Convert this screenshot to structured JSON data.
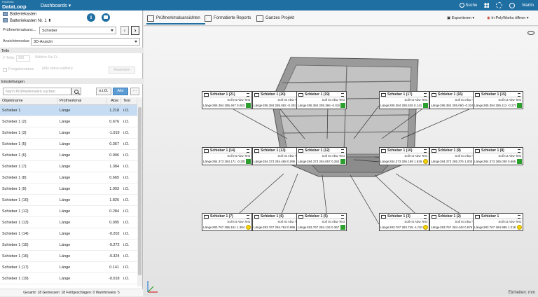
{
  "topbar": {
    "logo_small": "PolyWorks",
    "logo_large": "DataLoop",
    "menu": "Dashboards ▾",
    "search": "Suche",
    "user": "Martin"
  },
  "project": {
    "name": "Batteriekasten",
    "piece": "Batteriekasten Nr. 1"
  },
  "filters": {
    "feature_label": "Prüfmerkmalsans...",
    "feature_value": "Schieber",
    "view_label": "Ansichtsmodus:",
    "view_value": "3D-Ansicht"
  },
  "teile": {
    "header": "Teile",
    "count_label": "# Teile:",
    "count_value": "999",
    "select_placeholder": "Wählen Sie Fi...",
    "checkbox_label": "Freigabestatus",
    "select2_placeholder": "(Alle status wählen)",
    "apply": "Anwenden"
  },
  "settings_header": "Einstellungen",
  "search_placeholder": "Nach Prüfmerkmalen suchen",
  "filter_buttons": [
    "n.i.O.",
    "Alle"
  ],
  "more_button": "···",
  "table": {
    "headers": [
      "Objektname",
      "Prüfmerkmal",
      "Abw",
      "Test"
    ],
    "rows": [
      {
        "name": "Schieber 1",
        "feature": "Länge",
        "dev": "1.218",
        "test": "i.O."
      },
      {
        "name": "Schieber 1 (2)",
        "feature": "Länge",
        "dev": "0.676",
        "test": "i.O."
      },
      {
        "name": "Schieber 1 (3)",
        "feature": "Länge",
        "dev": "-1.019",
        "test": "i.O."
      },
      {
        "name": "Schieber 1 (5)",
        "feature": "Länge",
        "dev": "0.367",
        "test": "i.O."
      },
      {
        "name": "Schieber 1 (6)",
        "feature": "Länge",
        "dev": "0.996",
        "test": "i.O."
      },
      {
        "name": "Schieber 1 (7)",
        "feature": "Länge",
        "dev": "1.384",
        "test": "i.O."
      },
      {
        "name": "Schieber 1 (8)",
        "feature": "Länge",
        "dev": "0.665",
        "test": "i.O."
      },
      {
        "name": "Schieber 1 (9)",
        "feature": "Länge",
        "dev": "1.003",
        "test": "i.O."
      },
      {
        "name": "Schieber 1 (10)",
        "feature": "Länge",
        "dev": "1.826",
        "test": "i.O."
      },
      {
        "name": "Schieber 1 (12)",
        "feature": "Länge",
        "dev": "0.284",
        "test": "i.O."
      },
      {
        "name": "Schieber 1 (13)",
        "feature": "Länge",
        "dev": "0.095",
        "test": "i.O."
      },
      {
        "name": "Schieber 1 (14)",
        "feature": "Länge",
        "dev": "-0.202",
        "test": "i.O."
      },
      {
        "name": "Schieber 1 (15)",
        "feature": "Länge",
        "dev": "-0.272",
        "test": "i.O."
      },
      {
        "name": "Schieber 1 (16)",
        "feature": "Länge",
        "dev": "-0.324",
        "test": "i.O."
      },
      {
        "name": "Schieber 1 (17)",
        "feature": "Länge",
        "dev": "0.141",
        "test": "i.O."
      },
      {
        "name": "Schieber 1 (19)",
        "feature": "Länge",
        "dev": "-0.018",
        "test": "i.O."
      }
    ]
  },
  "status": "Gesamt: 18 Gemessen: 18 Fehlgeschlagen: 0 Warnhinweis: 5",
  "tabs": [
    "Prüfmerkmalsansichten",
    "Formatierte Reports",
    "Ganzes Projekt"
  ],
  "toolbar": {
    "export": "Exportieren ▾",
    "open": "In PolyWorks öffnen ▾"
  },
  "callout_subheader": "Soll      Ist  Abw Test",
  "callout_row_label": "Länge",
  "callouts": [
    {
      "title": "Schieber 1 (21)",
      "values": "285.384 285.467 0.083",
      "status": "ok"
    },
    {
      "title": "Schieber 1 (20)",
      "values": "285.384 285.082 -0.302",
      "status": "ok"
    },
    {
      "title": "Schieber 1 (19)",
      "values": "285.384 285.366 -0.018",
      "status": "ok"
    },
    {
      "title": "Schieber 1 (17)",
      "values": "285.384 285.525 0.141",
      "status": "ok"
    },
    {
      "title": "Schieber 1 (16)",
      "values": "285.384 285.060 -0.324",
      "status": "ok"
    },
    {
      "title": "Schieber 1 (15)",
      "values": "285.384 285.112 -0.272",
      "status": "ok"
    },
    {
      "title": "Schieber 1 (14)",
      "values": "284.373 284.171 -0.202",
      "status": "ok"
    },
    {
      "title": "Schieber 1 (13)",
      "values": "284.373 284.468 0.095",
      "status": "ok"
    },
    {
      "title": "Schieber 1 (12)",
      "values": "284.373 284.657 0.284",
      "status": "ok"
    },
    {
      "title": "Schieber 1 (10)",
      "values": "284.373 286.199 1.826",
      "status": "warn"
    },
    {
      "title": "Schieber 1 (9)",
      "values": "284.373 285.376 1.003",
      "status": "ok"
    },
    {
      "title": "Schieber 1 (8)",
      "values": "284.373 285.038 0.665",
      "status": "ok"
    },
    {
      "title": "Schieber 1 (7)",
      "values": "283.767 285.151 1.384",
      "status": "warn"
    },
    {
      "title": "Schieber 1 (6)",
      "values": "283.767 284.763 0.996",
      "status": "ok"
    },
    {
      "title": "Schieber 1 (5)",
      "values": "283.767 284.134 0.367",
      "status": "ok"
    },
    {
      "title": "Schieber 1 (3)",
      "values": "283.767 282.748 -1.019",
      "status": "warn"
    },
    {
      "title": "Schieber 1 (2)",
      "values": "283.767 284.443 0.676",
      "status": "warn"
    },
    {
      "title": "Schieber 1",
      "values": "283.767 284.985 1.218",
      "status": "warn"
    }
  ],
  "units": "Einheiten: mm",
  "colors": {
    "brand": "#1f6fa3",
    "ok": "#2ca02c",
    "warn": "#f4d400",
    "selected_row": "#c5dcf2"
  }
}
